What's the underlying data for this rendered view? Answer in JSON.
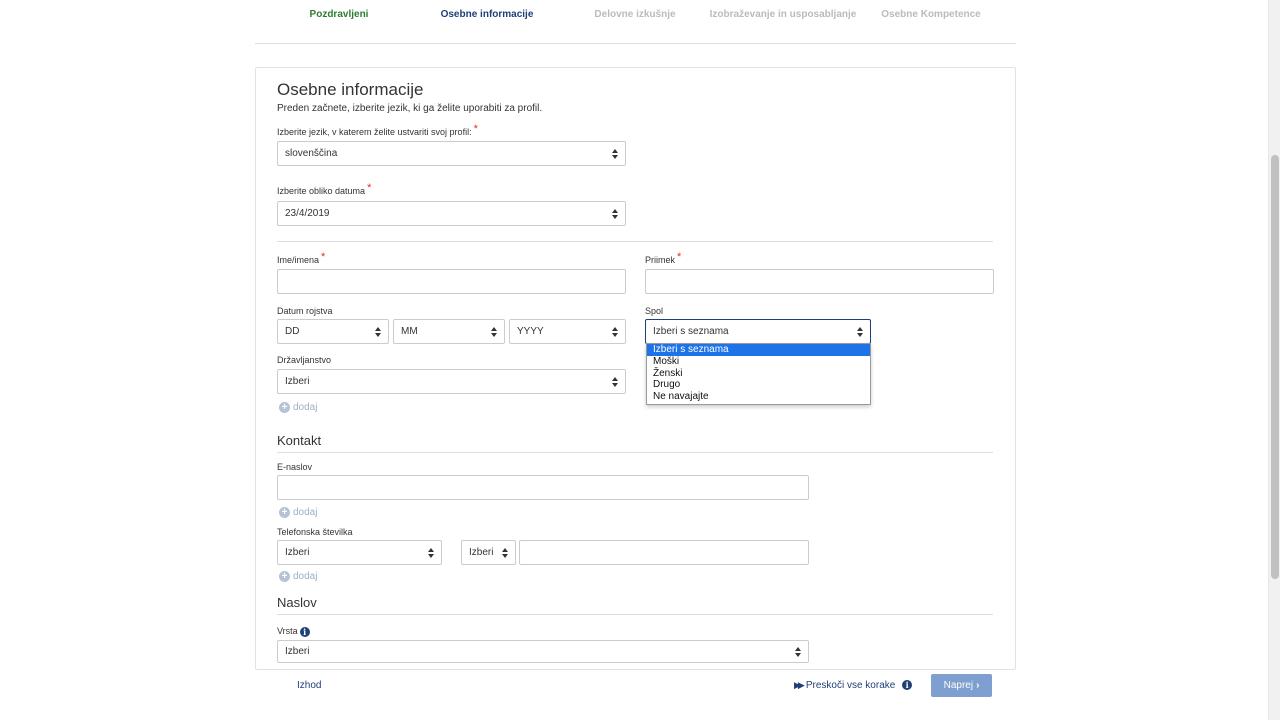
{
  "steps": [
    {
      "label": "Pozdravljeni",
      "state": "done"
    },
    {
      "label": "Osebne informacije",
      "state": "active"
    },
    {
      "label": "Delovne izkušnje",
      "state": "pending"
    },
    {
      "label": "Izobraževanje in usposabljanje",
      "state": "pending"
    },
    {
      "label": "Osebne Kompetence",
      "state": "pending"
    }
  ],
  "form": {
    "title": "Osebne informacije",
    "subtitle": "Preden začnete, izberite jezik, ki ga želite uporabiti za profil.",
    "language_label": "Izberite jezik, v katerem želite ustvariti svoj profil:",
    "language_value": "slovenščina",
    "date_format_label": "Izberite obliko datuma",
    "date_format_value": "23/4/2019",
    "first_name_label": "Ime/imena",
    "last_name_label": "Priimek",
    "birth_date_label": "Datum rojstva",
    "birth_day": "DD",
    "birth_month": "MM",
    "birth_year": "YYYY",
    "gender_label": "Spol",
    "gender_value": "Izberi s seznama",
    "gender_options": [
      "Izberi s seznama",
      "Moški",
      "Ženski",
      "Drugo",
      "Ne navajajte"
    ],
    "citizenship_label": "Državljanstvo",
    "citizenship_value": "Izberi",
    "add_label": "dodaj",
    "required_mark": "*"
  },
  "contact": {
    "title": "Kontakt",
    "email_label": "E-naslov",
    "phone_label": "Telefonska številka",
    "phone_type_value": "Izberi",
    "phone_code_value": "Izberi"
  },
  "address": {
    "title": "Naslov",
    "type_label": "Vrsta",
    "type_value": "Izberi"
  },
  "footer": {
    "exit_label": "Izhod",
    "skip_label": "Preskoči vse korake",
    "next_label": "Naprej"
  },
  "colors": {
    "accent": "#1f3f77",
    "done": "#2e7d32",
    "required": "#d9302c",
    "next_button": "#7e9fcf",
    "dropdown_highlight": "#1e73e8"
  }
}
